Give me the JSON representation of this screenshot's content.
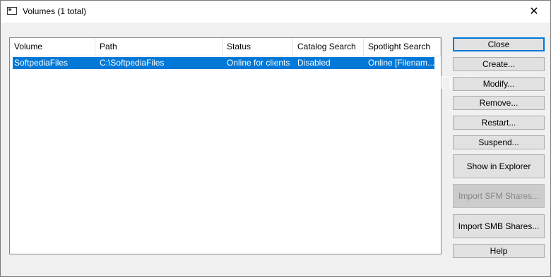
{
  "window": {
    "title": "Volumes (1 total)"
  },
  "table": {
    "columns": [
      "Volume",
      "Path",
      "Status",
      "Catalog Search",
      "Spotlight Search"
    ],
    "rows": [
      {
        "volume": "SoftpediaFiles",
        "path": "C:\\SoftpediaFiles",
        "status": "Online for clients",
        "catalog": "Disabled",
        "spotlight": "Online [Filenam..."
      }
    ]
  },
  "buttons": {
    "close": "Close",
    "create": "Create...",
    "modify": "Modify...",
    "remove": "Remove...",
    "restart": "Restart...",
    "suspend": "Suspend...",
    "show_explorer": "Show in Explorer",
    "import_sfm": "Import SFM Shares...",
    "import_smb": "Import SMB Shares...",
    "help": "Help"
  },
  "watermark": "SOFTPEDIA",
  "colors": {
    "selection": "#0078d7",
    "default_button_border": "#0078d7"
  }
}
